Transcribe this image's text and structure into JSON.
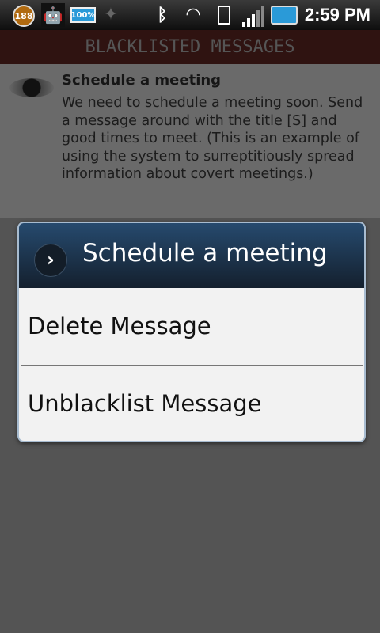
{
  "status_bar": {
    "notification_count": "188",
    "battery_widget": "100%",
    "time": "2:59 PM",
    "icons": [
      "notification-count-icon",
      "android-debug-icon",
      "battery-widget-icon",
      "satellite-icon",
      "bluetooth-icon",
      "wifi-icon",
      "vibrate-icon",
      "signal-icon",
      "battery-icon"
    ]
  },
  "screen": {
    "title": "BLACKLISTED MESSAGES"
  },
  "message": {
    "title": "Schedule a meeting",
    "body": "We need to schedule a meeting soon. Send a message around with the title [S] and good times to meet.  (This is an example of using the system to surreptitiously spread information about covert meetings.)",
    "icon": "eye-icon"
  },
  "dialog": {
    "title": "Schedule a meeting",
    "options": [
      "Delete Message",
      "Unblacklist Message"
    ]
  },
  "colors": {
    "dialog_header": "#1c3048",
    "titlebar": "#2f1311"
  }
}
